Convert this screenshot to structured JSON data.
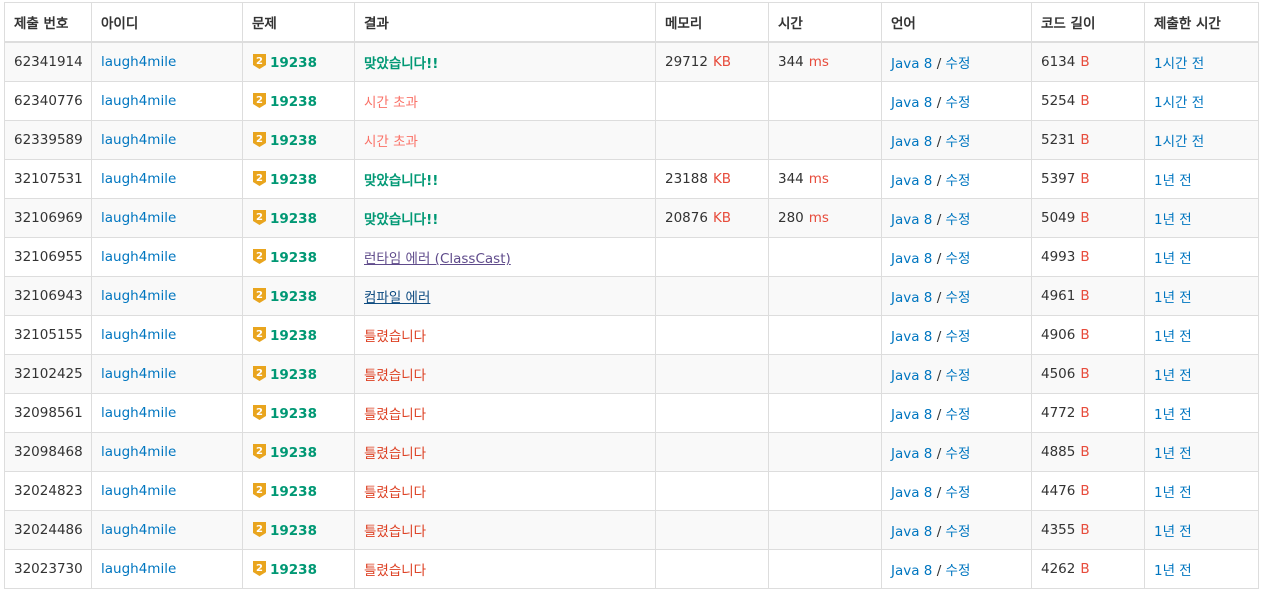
{
  "headers": [
    "제출 번호",
    "아이디",
    "문제",
    "결과",
    "메모리",
    "시간",
    "언어",
    "코드 길이",
    "제출한 시간"
  ],
  "units": {
    "memory": "KB",
    "time": "ms",
    "code": "B"
  },
  "colors": {
    "link": "#0076c0",
    "accepted": "#009874",
    "wrong": "#dd4124",
    "tle": "#fa7268",
    "rte": "#5f4b8b",
    "ce": "#0f4c81",
    "unit": "#e74c3c",
    "tier_badge": "#e9a51e"
  },
  "tier_icon": "tier-badge-icon",
  "rows": [
    {
      "id": "62341914",
      "user": "laugh4mile",
      "tier": "2",
      "problem": "19238",
      "result": "맞았습니다!!",
      "status": "ac",
      "memory": "29712",
      "time": "344",
      "lang": "Java 8",
      "edit": "수정",
      "code": "6134",
      "when": "1시간 전"
    },
    {
      "id": "62340776",
      "user": "laugh4mile",
      "tier": "2",
      "problem": "19238",
      "result": "시간 초과",
      "status": "tle",
      "memory": "",
      "time": "",
      "lang": "Java 8",
      "edit": "수정",
      "code": "5254",
      "when": "1시간 전"
    },
    {
      "id": "62339589",
      "user": "laugh4mile",
      "tier": "2",
      "problem": "19238",
      "result": "시간 초과",
      "status": "tle",
      "memory": "",
      "time": "",
      "lang": "Java 8",
      "edit": "수정",
      "code": "5231",
      "when": "1시간 전"
    },
    {
      "id": "32107531",
      "user": "laugh4mile",
      "tier": "2",
      "problem": "19238",
      "result": "맞았습니다!!",
      "status": "ac",
      "memory": "23188",
      "time": "344",
      "lang": "Java 8",
      "edit": "수정",
      "code": "5397",
      "when": "1년 전"
    },
    {
      "id": "32106969",
      "user": "laugh4mile",
      "tier": "2",
      "problem": "19238",
      "result": "맞았습니다!!",
      "status": "ac",
      "memory": "20876",
      "time": "280",
      "lang": "Java 8",
      "edit": "수정",
      "code": "5049",
      "when": "1년 전"
    },
    {
      "id": "32106955",
      "user": "laugh4mile",
      "tier": "2",
      "problem": "19238",
      "result": "런타임 에러 (ClassCast)",
      "status": "rte",
      "memory": "",
      "time": "",
      "lang": "Java 8",
      "edit": "수정",
      "code": "4993",
      "when": "1년 전"
    },
    {
      "id": "32106943",
      "user": "laugh4mile",
      "tier": "2",
      "problem": "19238",
      "result": "컴파일 에러",
      "status": "ce",
      "memory": "",
      "time": "",
      "lang": "Java 8",
      "edit": "수정",
      "code": "4961",
      "when": "1년 전"
    },
    {
      "id": "32105155",
      "user": "laugh4mile",
      "tier": "2",
      "problem": "19238",
      "result": "틀렸습니다",
      "status": "wa",
      "memory": "",
      "time": "",
      "lang": "Java 8",
      "edit": "수정",
      "code": "4906",
      "when": "1년 전"
    },
    {
      "id": "32102425",
      "user": "laugh4mile",
      "tier": "2",
      "problem": "19238",
      "result": "틀렸습니다",
      "status": "wa",
      "memory": "",
      "time": "",
      "lang": "Java 8",
      "edit": "수정",
      "code": "4506",
      "when": "1년 전"
    },
    {
      "id": "32098561",
      "user": "laugh4mile",
      "tier": "2",
      "problem": "19238",
      "result": "틀렸습니다",
      "status": "wa",
      "memory": "",
      "time": "",
      "lang": "Java 8",
      "edit": "수정",
      "code": "4772",
      "when": "1년 전"
    },
    {
      "id": "32098468",
      "user": "laugh4mile",
      "tier": "2",
      "problem": "19238",
      "result": "틀렸습니다",
      "status": "wa",
      "memory": "",
      "time": "",
      "lang": "Java 8",
      "edit": "수정",
      "code": "4885",
      "when": "1년 전"
    },
    {
      "id": "32024823",
      "user": "laugh4mile",
      "tier": "2",
      "problem": "19238",
      "result": "틀렸습니다",
      "status": "wa",
      "memory": "",
      "time": "",
      "lang": "Java 8",
      "edit": "수정",
      "code": "4476",
      "when": "1년 전"
    },
    {
      "id": "32024486",
      "user": "laugh4mile",
      "tier": "2",
      "problem": "19238",
      "result": "틀렸습니다",
      "status": "wa",
      "memory": "",
      "time": "",
      "lang": "Java 8",
      "edit": "수정",
      "code": "4355",
      "when": "1년 전"
    },
    {
      "id": "32023730",
      "user": "laugh4mile",
      "tier": "2",
      "problem": "19238",
      "result": "틀렸습니다",
      "status": "wa",
      "memory": "",
      "time": "",
      "lang": "Java 8",
      "edit": "수정",
      "code": "4262",
      "when": "1년 전"
    }
  ]
}
